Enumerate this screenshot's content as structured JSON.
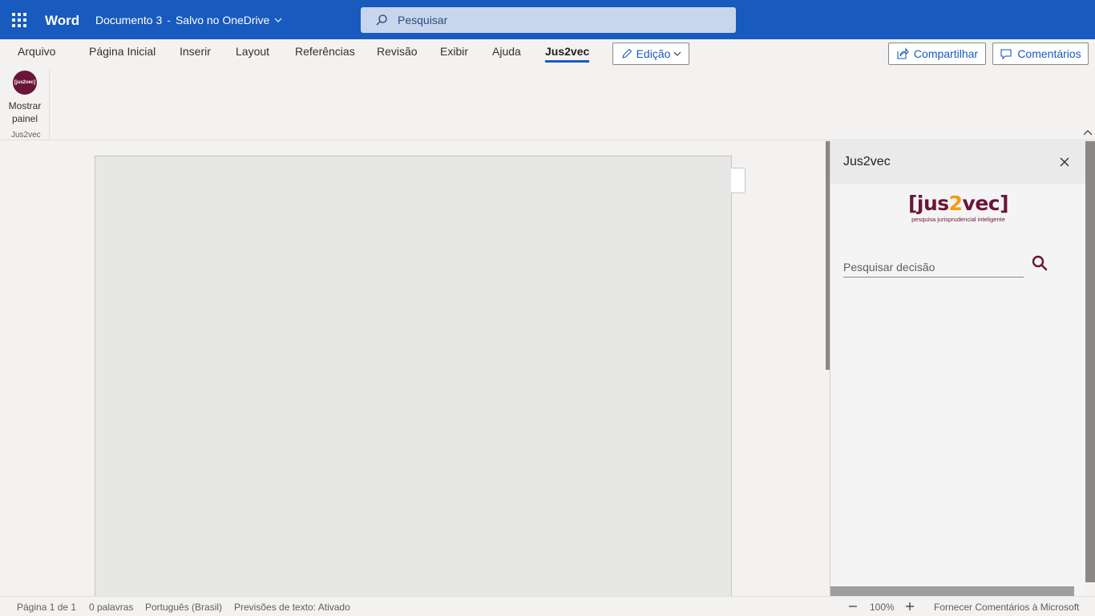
{
  "titlebar": {
    "app_name": "Word",
    "doc_name": "Documento 3",
    "separator": "-",
    "save_status": "Salvo no OneDrive",
    "search_placeholder": "Pesquisar",
    "bg_color": "#185abd"
  },
  "ribbon": {
    "tabs": [
      "Arquivo",
      "Página Inicial",
      "Inserir",
      "Layout",
      "Referências",
      "Revisão",
      "Exibir",
      "Ajuda",
      "Jus2vec"
    ],
    "active_tab": "Jus2vec",
    "edit_mode_label": "Edição",
    "share_label": "Compartilhar",
    "comments_label": "Comentários",
    "show_pane_line1": "Mostrar",
    "show_pane_line2": "painel",
    "group_label": "Jus2vec",
    "logo_text": "[jus2vec]"
  },
  "pane": {
    "title": "Jus2vec",
    "logo_open": "[jus",
    "logo_two": "2",
    "logo_close": "vec]",
    "logo_tagline": "pesquisa jurisprudencial inteligente",
    "search_placeholder": "Pesquisar decisão",
    "brand_color": "#6b1538",
    "accent_color": "#f39c12"
  },
  "statusbar": {
    "page": "Página 1 de 1",
    "words": "0 palavras",
    "language": "Português (Brasil)",
    "text_predictions": "Previsões de texto: Ativado",
    "zoom": "100%",
    "feedback": "Fornecer Comentários à Microsoft"
  }
}
